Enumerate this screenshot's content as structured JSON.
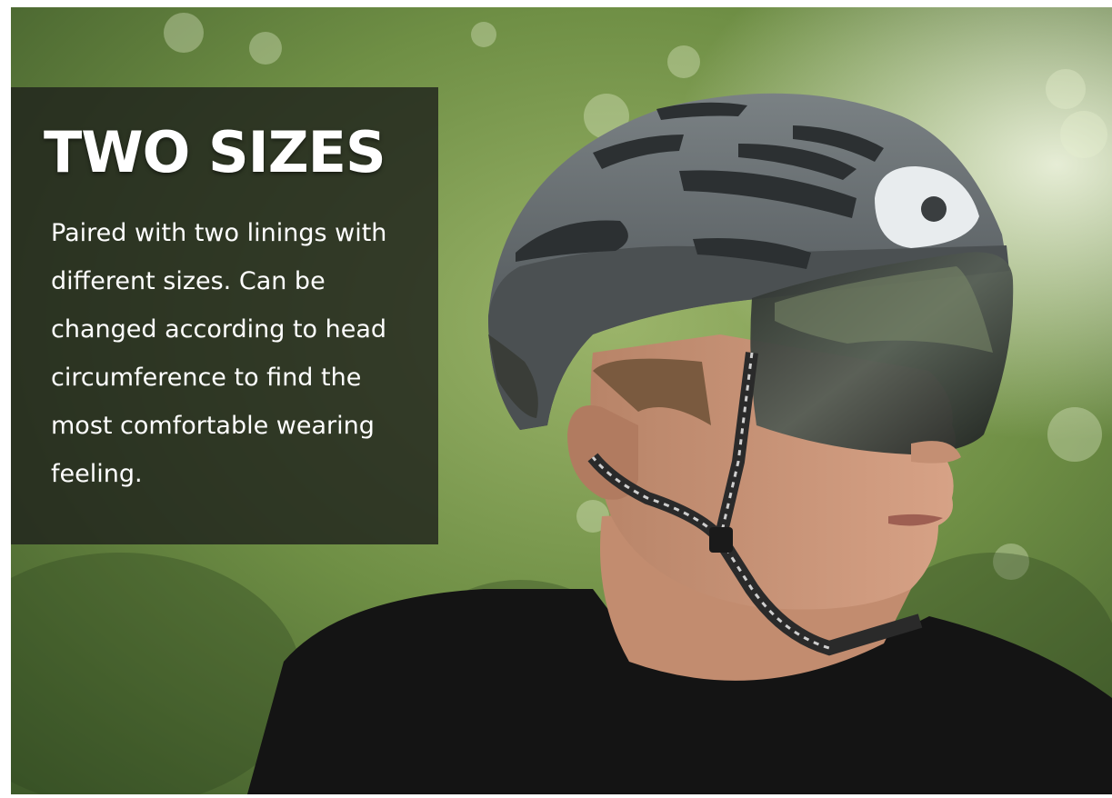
{
  "panel": {
    "headline": "TWO SIZES",
    "body": "Paired with two linings with different sizes. Can be changed according to head circumference to find the most comfortable wearing feeling."
  },
  "colors": {
    "panel_background": "#1e211c",
    "text": "#ffffff",
    "helmet": "#5f6568",
    "background_foliage": "#5c7a3e"
  },
  "icons": [
    "helmet-photo"
  ]
}
